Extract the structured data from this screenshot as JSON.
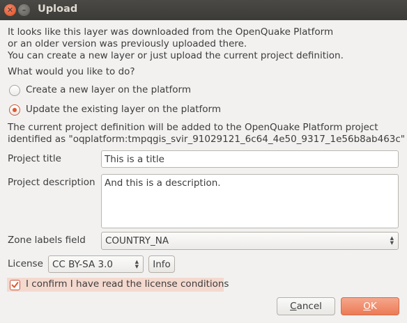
{
  "window": {
    "title": "Upload",
    "close_glyph": "✕",
    "minimize_glyph": "–"
  },
  "intro": {
    "line1": "It looks like this layer was downloaded from the OpenQuake Platform",
    "line2": "or an older version was previously uploaded there.",
    "line3": "You can create a new layer or just upload the current project definition."
  },
  "question": "What would you like to do?",
  "options": [
    {
      "label": "Create a new layer on the platform",
      "selected": false
    },
    {
      "label": "Update the existing layer on the platform",
      "selected": true
    }
  ],
  "info": {
    "line1": "The current project definition will be added to the OpenQuake Platform project",
    "line2": "identified as \"oqplatform:tmpqgis_svir_91029121_6c64_4e50_9317_1e56b8ab463c\""
  },
  "form": {
    "project_title_label": "Project title",
    "project_title_value": "This is a title",
    "project_description_label": "Project description",
    "project_description_value": "And this is a description.",
    "zone_labels_label": "Zone labels field",
    "zone_labels_value": "COUNTRY_NA",
    "license_label": "License",
    "license_value": "CC BY-SA 3.0",
    "info_button": "Info",
    "confirm_label": "I confirm I have read the license conditions",
    "confirm_checked": true
  },
  "buttons": {
    "cancel_first": "C",
    "cancel_rest": "ancel",
    "ok_first": "O",
    "ok_rest": "K"
  },
  "colors": {
    "accent": "#e0572e",
    "titlebar": "#3c3b37",
    "background": "#f2f1f0"
  }
}
